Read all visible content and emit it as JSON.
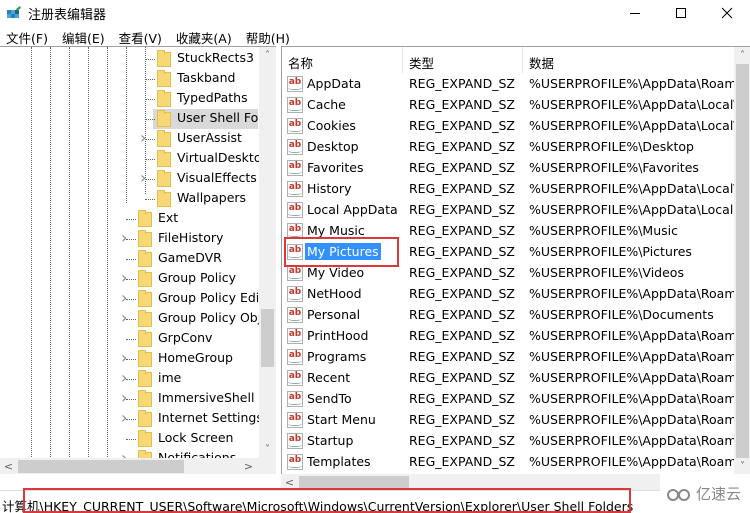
{
  "window": {
    "title": "注册表编辑器",
    "controls": {
      "minimize": "–",
      "maximize": "☐",
      "close": "✕"
    }
  },
  "menu": [
    {
      "label": "文件(F)"
    },
    {
      "label": "编辑(E)"
    },
    {
      "label": "查看(V)"
    },
    {
      "label": "收藏夹(A)"
    },
    {
      "label": "帮助(H)"
    }
  ],
  "tree": {
    "items": [
      {
        "label": "StuckRects3",
        "level": 2,
        "expandable": false
      },
      {
        "label": "Taskband",
        "level": 2,
        "expandable": false
      },
      {
        "label": "TypedPaths",
        "level": 2,
        "expandable": false
      },
      {
        "label": "User Shell Folders",
        "level": 2,
        "expandable": false,
        "selected": true
      },
      {
        "label": "UserAssist",
        "level": 2,
        "expandable": true
      },
      {
        "label": "VirtualDesktops",
        "level": 2,
        "expandable": false
      },
      {
        "label": "VisualEffects",
        "level": 2,
        "expandable": true
      },
      {
        "label": "Wallpapers",
        "level": 2,
        "expandable": false
      },
      {
        "label": "Ext",
        "level": 1,
        "expandable": false
      },
      {
        "label": "FileHistory",
        "level": 1,
        "expandable": true
      },
      {
        "label": "GameDVR",
        "level": 1,
        "expandable": false
      },
      {
        "label": "Group Policy",
        "level": 1,
        "expandable": true
      },
      {
        "label": "Group Policy Editor",
        "level": 1,
        "expandable": true
      },
      {
        "label": "Group Policy Objects",
        "level": 1,
        "expandable": true
      },
      {
        "label": "GrpConv",
        "level": 1,
        "expandable": false
      },
      {
        "label": "HomeGroup",
        "level": 1,
        "expandable": true
      },
      {
        "label": "ime",
        "level": 1,
        "expandable": true
      },
      {
        "label": "ImmersiveShell",
        "level": 1,
        "expandable": true
      },
      {
        "label": "Internet Settings",
        "level": 1,
        "expandable": true
      },
      {
        "label": "Lock Screen",
        "level": 1,
        "expandable": false
      },
      {
        "label": "Notifications",
        "level": 1,
        "expandable": true
      }
    ],
    "scroll": {
      "up": "˄",
      "down": "˅",
      "left": "<",
      "right": ">"
    }
  },
  "list": {
    "columns": {
      "name": "名称",
      "type": "类型",
      "data": "数据"
    },
    "rows": [
      {
        "name": "AppData",
        "type": "REG_EXPAND_SZ",
        "data": "%USERPROFILE%\\AppData\\Roaming"
      },
      {
        "name": "Cache",
        "type": "REG_EXPAND_SZ",
        "data": "%USERPROFILE%\\AppData\\Local\\Microsoft"
      },
      {
        "name": "Cookies",
        "type": "REG_EXPAND_SZ",
        "data": "%USERPROFILE%\\AppData\\Local\\Microsoft"
      },
      {
        "name": "Desktop",
        "type": "REG_EXPAND_SZ",
        "data": "%USERPROFILE%\\Desktop"
      },
      {
        "name": "Favorites",
        "type": "REG_EXPAND_SZ",
        "data": "%USERPROFILE%\\Favorites"
      },
      {
        "name": "History",
        "type": "REG_EXPAND_SZ",
        "data": "%USERPROFILE%\\AppData\\Local\\Microsoft"
      },
      {
        "name": "Local AppData",
        "type": "REG_EXPAND_SZ",
        "data": "%USERPROFILE%\\AppData\\Local"
      },
      {
        "name": "My Music",
        "type": "REG_EXPAND_SZ",
        "data": "%USERPROFILE%\\Music"
      },
      {
        "name": "My Pictures",
        "type": "REG_EXPAND_SZ",
        "data": "%USERPROFILE%\\Pictures",
        "selected": true
      },
      {
        "name": "My Video",
        "type": "REG_EXPAND_SZ",
        "data": "%USERPROFILE%\\Videos"
      },
      {
        "name": "NetHood",
        "type": "REG_EXPAND_SZ",
        "data": "%USERPROFILE%\\AppData\\Roaming"
      },
      {
        "name": "Personal",
        "type": "REG_EXPAND_SZ",
        "data": "%USERPROFILE%\\Documents"
      },
      {
        "name": "PrintHood",
        "type": "REG_EXPAND_SZ",
        "data": "%USERPROFILE%\\AppData\\Roaming"
      },
      {
        "name": "Programs",
        "type": "REG_EXPAND_SZ",
        "data": "%USERPROFILE%\\AppData\\Roaming"
      },
      {
        "name": "Recent",
        "type": "REG_EXPAND_SZ",
        "data": "%USERPROFILE%\\AppData\\Roaming"
      },
      {
        "name": "SendTo",
        "type": "REG_EXPAND_SZ",
        "data": "%USERPROFILE%\\AppData\\Roaming"
      },
      {
        "name": "Start Menu",
        "type": "REG_EXPAND_SZ",
        "data": "%USERPROFILE%\\AppData\\Roaming"
      },
      {
        "name": "Startup",
        "type": "REG_EXPAND_SZ",
        "data": "%USERPROFILE%\\AppData\\Roaming"
      },
      {
        "name": "Templates",
        "type": "REG_EXPAND_SZ",
        "data": "%USERPROFILE%\\AppData\\Roaming"
      }
    ],
    "value_icon": "ab",
    "scroll": {
      "up": "˄",
      "down": "˅",
      "left": "<"
    }
  },
  "statusbar": {
    "path": "计算机\\HKEY_CURRENT_USER\\Software\\Microsoft\\Windows\\CurrentVersion\\Explorer\\User Shell Folders"
  },
  "watermark": {
    "text": "亿速云"
  },
  "colors": {
    "selection": "#3390ff",
    "highlight_box": "#d9393a",
    "folder": "#f8d775",
    "tree_selected": "#d9d9d9"
  }
}
